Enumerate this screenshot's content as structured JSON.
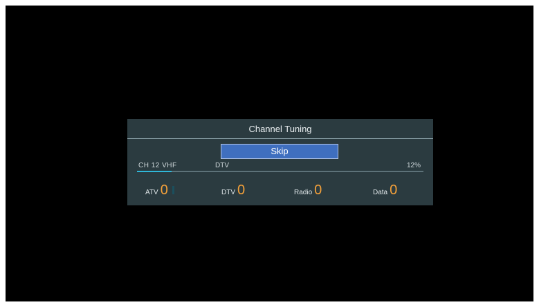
{
  "dialog": {
    "title": "Channel Tuning",
    "skip_label": "Skip"
  },
  "scan": {
    "channel_text": "CH  12  VHF",
    "mode": "DTV",
    "percent_text": "12%",
    "progress": 0.12
  },
  "counts": {
    "atv": {
      "label": "ATV",
      "value": "0"
    },
    "dtv": {
      "label": "DTV",
      "value": "0"
    },
    "radio": {
      "label": "Radio",
      "value": "0"
    },
    "data": {
      "label": "Data",
      "value": "0"
    }
  },
  "colors": {
    "dialog_bg": "#2b3b40",
    "skip_bg": "#3f6fbf",
    "count_value": "#f4a13a",
    "progress": "#2fb7d9"
  }
}
